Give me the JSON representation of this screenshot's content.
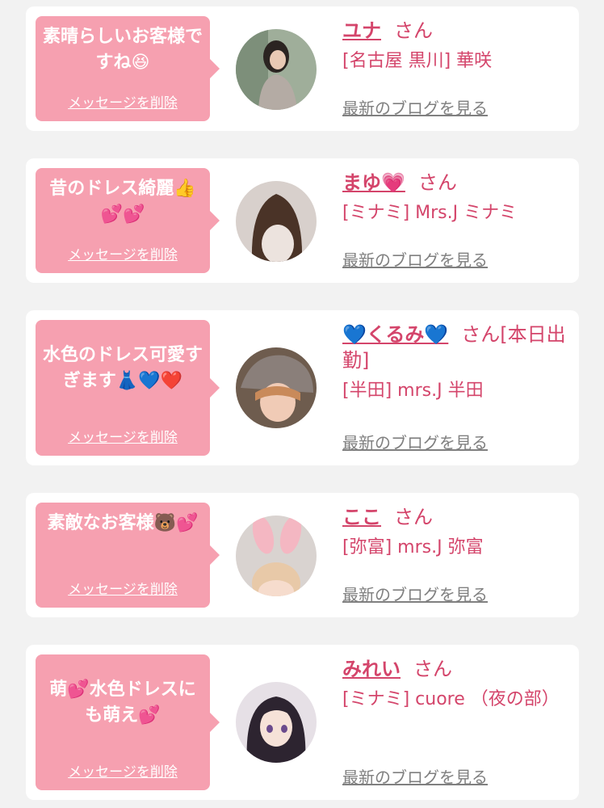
{
  "cards": [
    {
      "message": "素晴らしいお客様ですね😆",
      "delete_label": "メッセージを削除",
      "name": "ユナ",
      "suffix": "さん",
      "shop": "[名古屋 黒川] 華咲",
      "blog_label": "最新のブログを見る"
    },
    {
      "message": "昔のドレス綺麗👍💕💕",
      "delete_label": "メッセージを削除",
      "name": "まゆ💗",
      "suffix": "さん",
      "shop": "[ミナミ] Mrs.J ミナミ",
      "blog_label": "最新のブログを見る"
    },
    {
      "message": "水色のドレス可愛すぎます👗💙❤️",
      "delete_label": "メッセージを削除",
      "name": "💙くるみ💙",
      "suffix": "さん[本日出勤]",
      "shop": "[半田] mrs.J 半田",
      "blog_label": "最新のブログを見る"
    },
    {
      "message": "素敵なお客様🐻💕",
      "delete_label": "メッセージを削除",
      "name": "ここ",
      "suffix": "さん",
      "shop": "[弥富] mrs.J 弥富",
      "blog_label": "最新のブログを見る"
    },
    {
      "message": "萌💕水色ドレスにも萌え💕",
      "delete_label": "メッセージを削除",
      "name": "みれい",
      "suffix": "さん",
      "shop": "[ミナミ] cuore （夜の部）",
      "blog_label": "最新のブログを見る"
    }
  ]
}
